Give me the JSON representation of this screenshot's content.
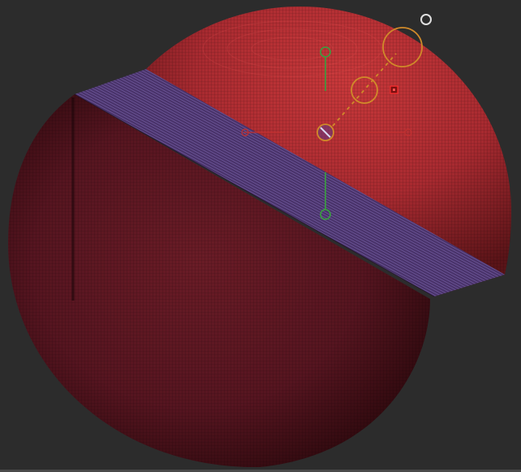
{
  "viewport": {
    "label": "",
    "background": "#2c2c2c"
  },
  "colors": {
    "mesh_lower": "#5a1620",
    "mesh_upper": "#b02a30",
    "slice_band": "#4a2e66",
    "gizmo_orange": "#d08a2a",
    "gizmo_green": "#3aa040",
    "gizmo_red": "#c03030",
    "cursor_white": "#e0e0e0"
  },
  "icons": {
    "camera_pivot": "circle-outline-icon",
    "gizmo_center": "ring-slash-icon",
    "gizmo_handle": "ring-icon",
    "marker": "square-marker-icon"
  }
}
